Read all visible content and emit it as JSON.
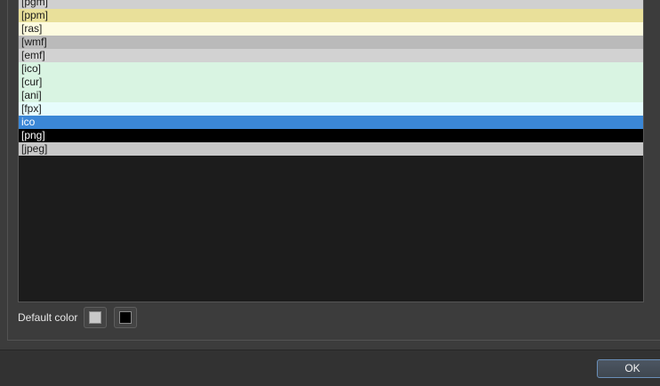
{
  "list": {
    "items": [
      {
        "label": "[pgm]",
        "bg": "#d0d0d0",
        "fg": "#1a1a1a"
      },
      {
        "label": "[ppm]",
        "bg": "#e9e09a",
        "fg": "#1a1a1a"
      },
      {
        "label": "[ras]",
        "bg": "#fdfbdf",
        "fg": "#1a1a1a"
      },
      {
        "label": "[wmf]",
        "bg": "#bababa",
        "fg": "#1a1a1a"
      },
      {
        "label": "[emf]",
        "bg": "#d2d2d2",
        "fg": "#1a1a1a"
      },
      {
        "label": "[ico]",
        "bg": "#d9f4e2",
        "fg": "#1a1a1a"
      },
      {
        "label": "[cur]",
        "bg": "#d9f4e2",
        "fg": "#1a1a1a"
      },
      {
        "label": "[ani]",
        "bg": "#d9f4e2",
        "fg": "#1a1a1a"
      },
      {
        "label": "[fpx]",
        "bg": "#e6fcfc",
        "fg": "#1a1a1a"
      },
      {
        "label": "ico",
        "bg": "#3b87d6",
        "fg": "#ffffff",
        "selected": true
      },
      {
        "label": "[png]",
        "bg": "#000000",
        "fg": "#ffffff"
      },
      {
        "label": "[jpeg]",
        "bg": "#c8c8c8",
        "fg": "#1a1a1a"
      }
    ]
  },
  "default_color": {
    "label": "Default color",
    "background_swatch": "#c8c8c8",
    "foreground_swatch": "#000000"
  },
  "footer": {
    "ok_label": "OK"
  }
}
